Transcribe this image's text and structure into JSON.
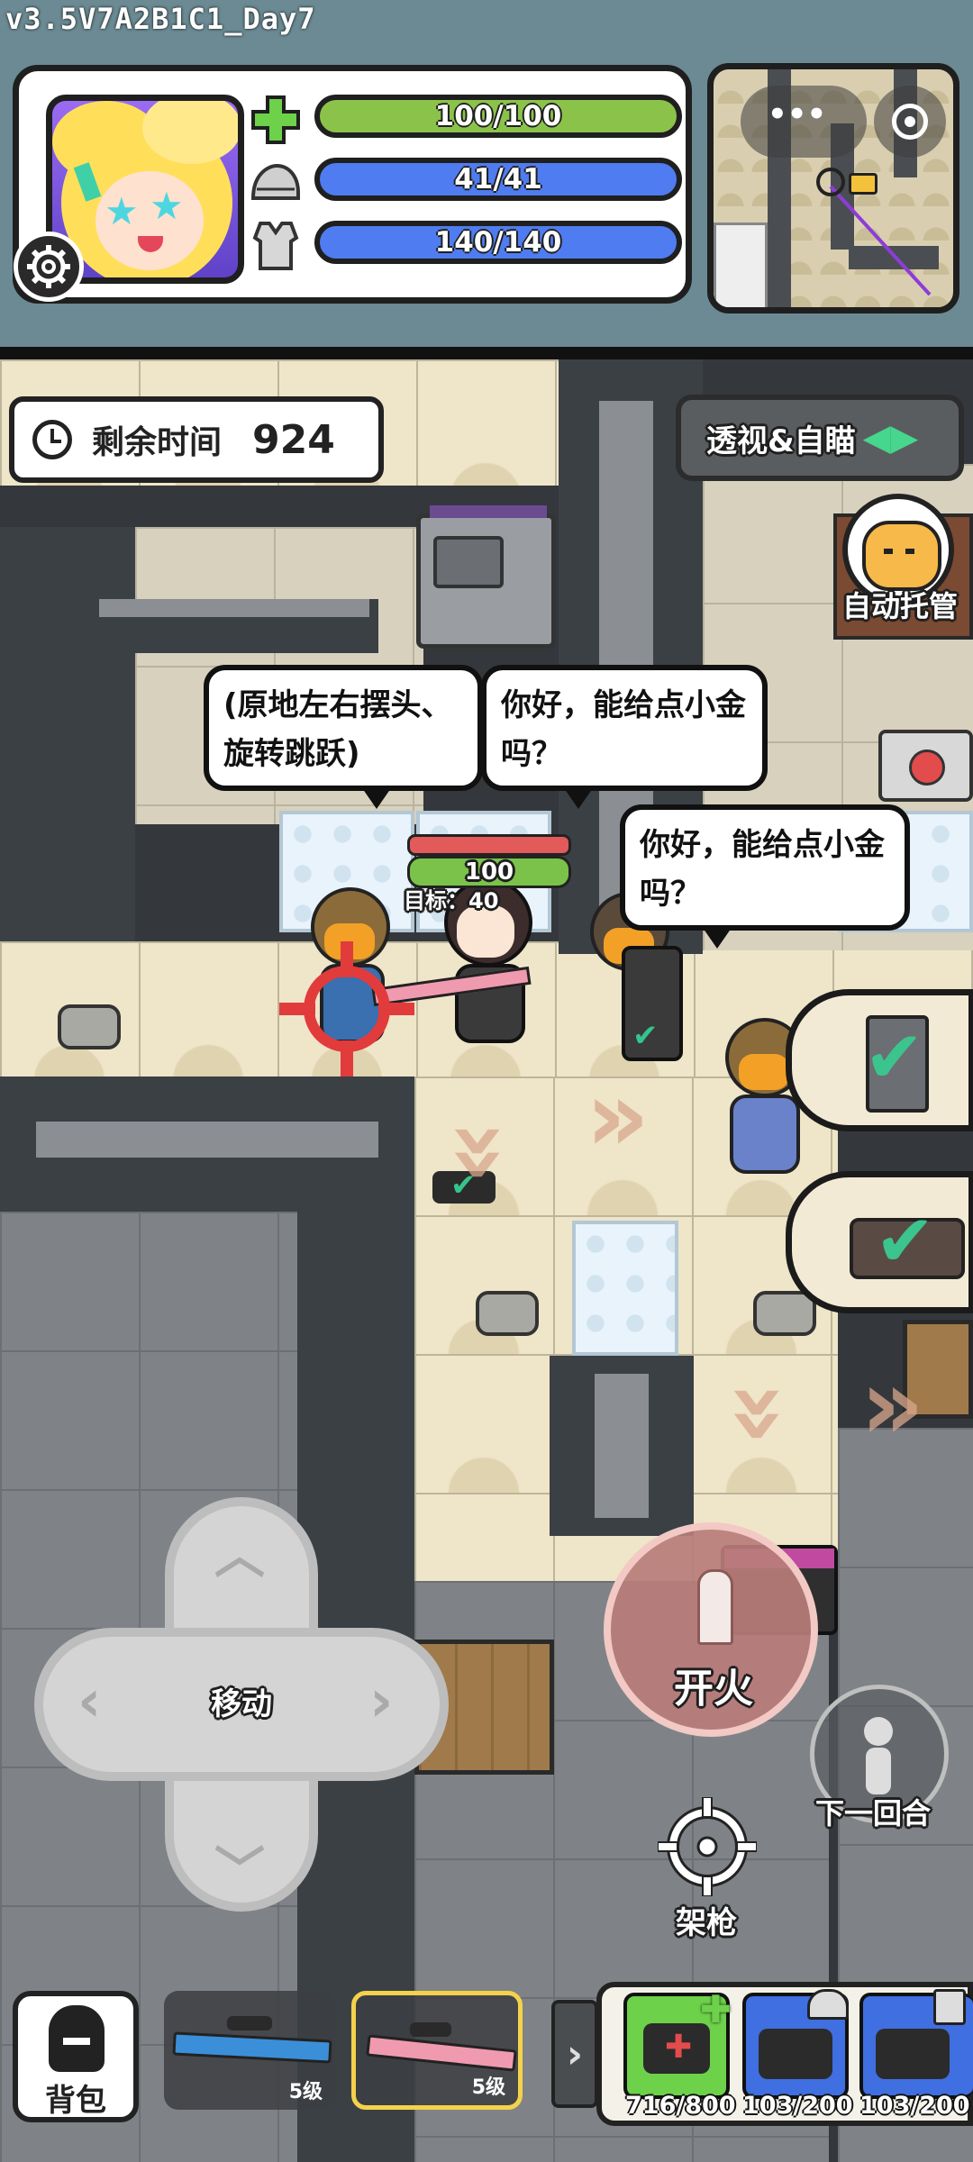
{
  "version_label": "v3.5V7A2B1C1_Day7",
  "stats": {
    "health": "100/100",
    "helmet": "41/41",
    "armor": "140/140"
  },
  "timer": {
    "label": "剩余时间",
    "value": "924"
  },
  "vision_button": "透视&自瞄",
  "auto_button": "自动托管",
  "bubbles": [
    "(原地左右摆头、旋转跳跃)",
    "你好，能给点小金吗？",
    "你好，能给点小金吗？"
  ],
  "target": {
    "hp": "100",
    "label": "目标：40"
  },
  "controls": {
    "move": "移动",
    "fire": "开火",
    "next_round": "下一回合",
    "aim": "架枪",
    "backpack": "背包"
  },
  "weapons": [
    {
      "level": "5级",
      "selected": false
    },
    {
      "level": "5级",
      "selected": true
    }
  ],
  "items": [
    {
      "icon": "medkit-icon",
      "count": "716/800",
      "color": "#6dd14a"
    },
    {
      "icon": "helmet-repair-icon",
      "count": "103/200",
      "color": "#3f6fe0"
    },
    {
      "icon": "armor-repair-icon",
      "count": "103/200",
      "color": "#3f6fe0"
    }
  ],
  "colors": {
    "health_bar": "#8bc34a",
    "shield_bar": "#4f7cf0",
    "fire_button": "#b97d79",
    "selected_weapon": "#f4d24a"
  }
}
